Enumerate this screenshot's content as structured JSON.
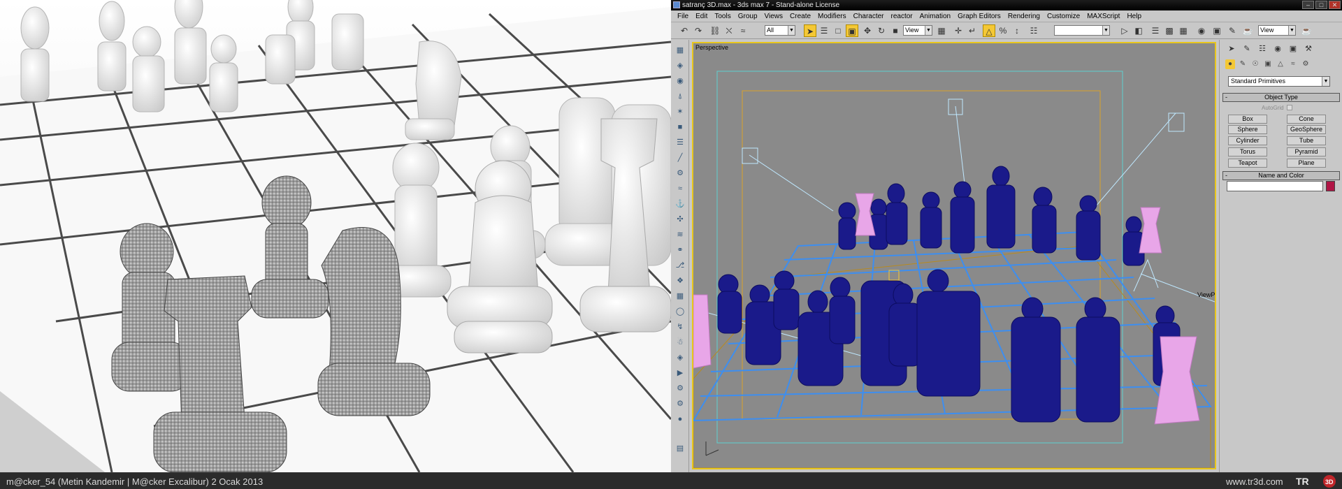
{
  "window": {
    "title": "satranç 3D.max - 3ds max 7  - Stand-alone License",
    "minimize_icon": "minimize-icon",
    "maximize_icon": "maximize-icon",
    "close_icon": "close-icon"
  },
  "menu": {
    "items": [
      "File",
      "Edit",
      "Tools",
      "Group",
      "Views",
      "Create",
      "Modifiers",
      "Character",
      "reactor",
      "Animation",
      "Graph Editors",
      "Rendering",
      "Customize",
      "MAXScript",
      "Help"
    ]
  },
  "toolbar": {
    "selection_filter": "All",
    "ref_coord_system": "View",
    "named_selection": "",
    "viewport_shading": "View"
  },
  "viewport": {
    "label": "Perspective",
    "view_plane_label": "ViewPlane"
  },
  "command_panel": {
    "category_dropdown": "Standard Primitives",
    "object_type_rollout": "Object Type",
    "autogrid_label": "AutoGrid",
    "primitives": [
      "Box",
      "Cone",
      "Sphere",
      "GeoSphere",
      "Cylinder",
      "Tube",
      "Torus",
      "Pyramid",
      "Teapot",
      "Plane"
    ],
    "name_color_rollout": "Name and Color",
    "object_name": "",
    "object_color": "#b01545"
  },
  "status": {
    "credit": "m@cker_54 (Metin Kandemir | M@cker Excalibur)  2 Ocak 2013",
    "site": "www.tr3d.com",
    "logo_text": "TR3D"
  },
  "colors": {
    "accent": "#f4c835",
    "piece_selected": "#1a1a8a",
    "piece_frozen": "#e8a6e8",
    "grid": "#3d8ef0"
  }
}
